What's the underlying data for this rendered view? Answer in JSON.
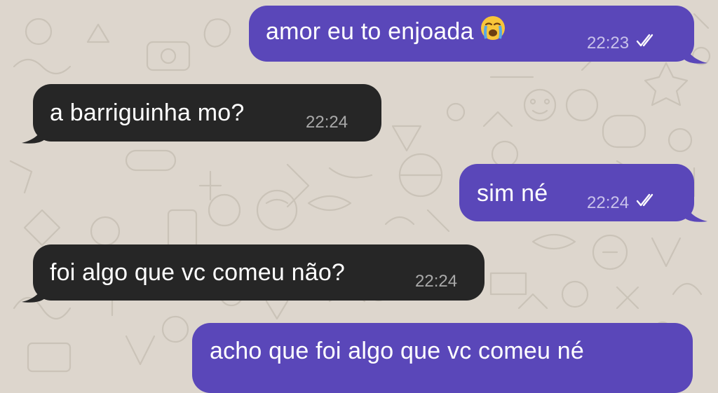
{
  "chat": {
    "messages": [
      {
        "direction": "outgoing",
        "text": "amor eu to enjoada",
        "emoji": "loudly-crying-face",
        "time": "22:23",
        "status": "read-double-check"
      },
      {
        "direction": "incoming",
        "text": "a barriguinha mo?",
        "time": "22:24"
      },
      {
        "direction": "outgoing",
        "text": "sim né",
        "time": "22:24",
        "status": "read-double-check"
      },
      {
        "direction": "incoming",
        "text": "foi algo que vc comeu não?",
        "time": "22:24"
      },
      {
        "direction": "outgoing",
        "text": "acho que foi algo que vc comeu né",
        "time": ""
      }
    ]
  },
  "colors": {
    "background": "#ddd6cd",
    "outgoing_bubble": "#5a47b9",
    "incoming_bubble": "#262626",
    "message_text": "#ffffff"
  },
  "icons": {
    "read_receipt": "double-check-icon",
    "tail": "bubble-tail"
  }
}
